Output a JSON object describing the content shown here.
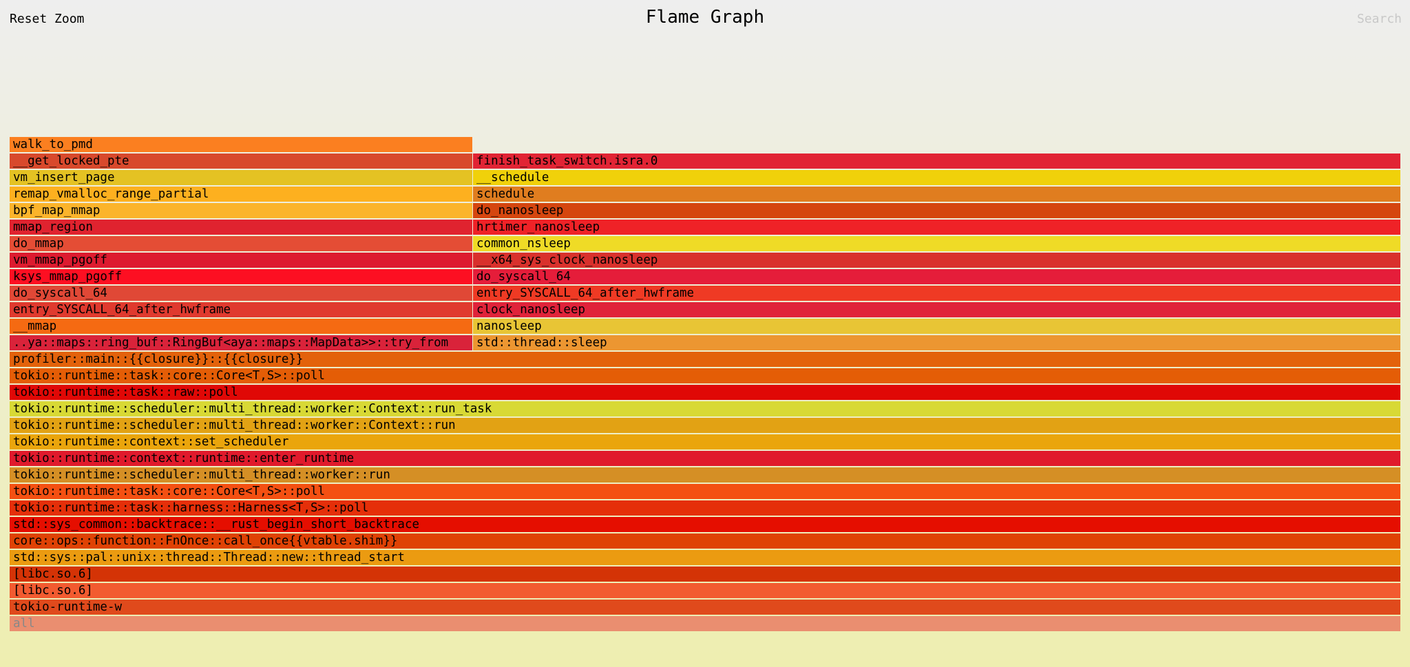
{
  "header": {
    "reset_zoom_label": "Reset Zoom",
    "title": "Flame Graph",
    "search_label": "Search"
  },
  "flamegraph": {
    "unit": "samples",
    "total": 1000,
    "frames": [
      {
        "name": "all",
        "depth": 0,
        "start": 0,
        "width": 1000,
        "color": "#ea8e70"
      },
      {
        "name": "tokio-runtime-w",
        "depth": 1,
        "start": 0,
        "width": 1000,
        "color": "#e04a1c"
      },
      {
        "name": "[libc.so.6]",
        "depth": 2,
        "start": 0,
        "width": 1000,
        "color": "#f25b30"
      },
      {
        "name": "[libc.so.6]",
        "depth": 3,
        "start": 0,
        "width": 1000,
        "color": "#d43306"
      },
      {
        "name": "std::sys::pal::unix::thread::Thread::new::thread_start",
        "depth": 4,
        "start": 0,
        "width": 1000,
        "color": "#eb9b11"
      },
      {
        "name": "core::ops::function::FnOnce::call_once{{vtable.shim}}",
        "depth": 5,
        "start": 0,
        "width": 1000,
        "color": "#df4204"
      },
      {
        "name": "std::sys_common::backtrace::__rust_begin_short_backtrace",
        "depth": 6,
        "start": 0,
        "width": 1000,
        "color": "#e50e00"
      },
      {
        "name": "tokio::runtime::task::harness::Harness<T,S>::poll",
        "depth": 7,
        "start": 0,
        "width": 1000,
        "color": "#e52f09"
      },
      {
        "name": "tokio::runtime::task::core::Core<T,S>::poll",
        "depth": 8,
        "start": 0,
        "width": 1000,
        "color": "#f45012"
      },
      {
        "name": "tokio::runtime::scheduler::multi_thread::worker::run",
        "depth": 9,
        "start": 0,
        "width": 1000,
        "color": "#d58f25"
      },
      {
        "name": "tokio::runtime::context::runtime::enter_runtime",
        "depth": 10,
        "start": 0,
        "width": 1000,
        "color": "#e01a2c"
      },
      {
        "name": "tokio::runtime::context::set_scheduler",
        "depth": 11,
        "start": 0,
        "width": 1000,
        "color": "#eaa50c"
      },
      {
        "name": "tokio::runtime::scheduler::multi_thread::worker::Context::run",
        "depth": 12,
        "start": 0,
        "width": 1000,
        "color": "#e2a214"
      },
      {
        "name": "tokio::runtime::scheduler::multi_thread::worker::Context::run_task",
        "depth": 13,
        "start": 0,
        "width": 1000,
        "color": "#d8d935"
      },
      {
        "name": "tokio::runtime::task::raw::poll",
        "depth": 14,
        "start": 0,
        "width": 1000,
        "color": "#e00806"
      },
      {
        "name": "tokio::runtime::task::core::Core<T,S>::poll",
        "depth": 15,
        "start": 0,
        "width": 1000,
        "color": "#e45d06"
      },
      {
        "name": "profiler::main::{{closure}}::{{closure}}",
        "depth": 16,
        "start": 0,
        "width": 1000,
        "color": "#e3620b"
      },
      {
        "name": "..ya::maps::ring_buf::RingBuf<aya::maps::MapData>>::try_from",
        "depth": 17,
        "start": 0,
        "width": 333,
        "color": "#d9233a"
      },
      {
        "name": "std::thread::sleep",
        "depth": 17,
        "start": 333,
        "width": 667,
        "color": "#ec9631"
      },
      {
        "name": "__mmap",
        "depth": 18,
        "start": 0,
        "width": 333,
        "color": "#f56a12"
      },
      {
        "name": "nanosleep",
        "depth": 18,
        "start": 333,
        "width": 667,
        "color": "#e8c535"
      },
      {
        "name": "entry_SYSCALL_64_after_hwframe",
        "depth": 19,
        "start": 0,
        "width": 333,
        "color": "#e03a2e"
      },
      {
        "name": "clock_nanosleep",
        "depth": 19,
        "start": 333,
        "width": 667,
        "color": "#e0233a"
      },
      {
        "name": "do_syscall_64",
        "depth": 20,
        "start": 0,
        "width": 333,
        "color": "#e04836"
      },
      {
        "name": "entry_SYSCALL_64_after_hwframe",
        "depth": 20,
        "start": 333,
        "width": 667,
        "color": "#ef3a24"
      },
      {
        "name": "ksys_mmap_pgoff",
        "depth": 21,
        "start": 0,
        "width": 333,
        "color": "#fd0f22"
      },
      {
        "name": "do_syscall_64",
        "depth": 21,
        "start": 333,
        "width": 667,
        "color": "#e51d3a"
      },
      {
        "name": "vm_mmap_pgoff",
        "depth": 22,
        "start": 0,
        "width": 333,
        "color": "#dd1b2f"
      },
      {
        "name": "__x64_sys_clock_nanosleep",
        "depth": 22,
        "start": 333,
        "width": 667,
        "color": "#d9312c"
      },
      {
        "name": "do_mmap",
        "depth": 23,
        "start": 0,
        "width": 333,
        "color": "#e44d35"
      },
      {
        "name": "common_nsleep",
        "depth": 23,
        "start": 333,
        "width": 667,
        "color": "#efdb26"
      },
      {
        "name": "mmap_region",
        "depth": 24,
        "start": 0,
        "width": 333,
        "color": "#e0232f"
      },
      {
        "name": "hrtimer_nanosleep",
        "depth": 24,
        "start": 333,
        "width": 667,
        "color": "#ef2227"
      },
      {
        "name": "bpf_map_mmap",
        "depth": 25,
        "start": 0,
        "width": 333,
        "color": "#fbb42b"
      },
      {
        "name": "do_nanosleep",
        "depth": 25,
        "start": 333,
        "width": 667,
        "color": "#d5460f"
      },
      {
        "name": "remap_vmalloc_range_partial",
        "depth": 26,
        "start": 0,
        "width": 333,
        "color": "#fdb01f"
      },
      {
        "name": "schedule",
        "depth": 26,
        "start": 333,
        "width": 667,
        "color": "#e07d1f"
      },
      {
        "name": "vm_insert_page",
        "depth": 27,
        "start": 0,
        "width": 333,
        "color": "#e4c223"
      },
      {
        "name": "__schedule",
        "depth": 27,
        "start": 333,
        "width": 667,
        "color": "#f0d10a"
      },
      {
        "name": "__get_locked_pte",
        "depth": 28,
        "start": 0,
        "width": 333,
        "color": "#d8492c"
      },
      {
        "name": "finish_task_switch.isra.0",
        "depth": 28,
        "start": 333,
        "width": 667,
        "color": "#e12434"
      },
      {
        "name": "walk_to_pmd",
        "depth": 29,
        "start": 0,
        "width": 333,
        "color": "#fb7f20"
      }
    ]
  }
}
